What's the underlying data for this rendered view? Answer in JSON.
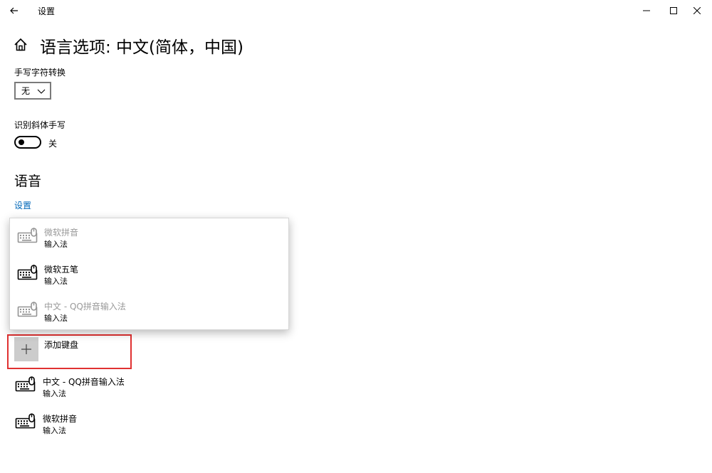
{
  "titlebar": {
    "title": "设置",
    "back_icon": "back-arrow-icon",
    "controls": [
      "minimize-icon",
      "maximize-icon",
      "close-icon"
    ]
  },
  "header": {
    "home_icon": "home-icon",
    "title": "语言选项: 中文(简体，中国)"
  },
  "handwriting": {
    "label": "手写字符转换",
    "selected": "无"
  },
  "slant": {
    "label": "识别斜体手写",
    "state": "关"
  },
  "speech": {
    "title": "语音",
    "link": "设置"
  },
  "popup": {
    "items": [
      {
        "name": "微软拼音",
        "sub": "输入法",
        "disabled": true
      },
      {
        "name": "微软五笔",
        "sub": "输入法",
        "disabled": false
      },
      {
        "name": "中文 - QQ拼音输入法",
        "sub": "输入法",
        "disabled": true
      }
    ]
  },
  "add_keyboard": {
    "label": "添加键盘",
    "icon": "plus-icon"
  },
  "keyboards": [
    {
      "name": "中文 - QQ拼音输入法",
      "sub": "输入法"
    },
    {
      "name": "微软拼音",
      "sub": "输入法"
    }
  ],
  "colors": {
    "link": "#0067b8",
    "highlight_border": "#e03131",
    "add_tile": "#cccccc"
  }
}
